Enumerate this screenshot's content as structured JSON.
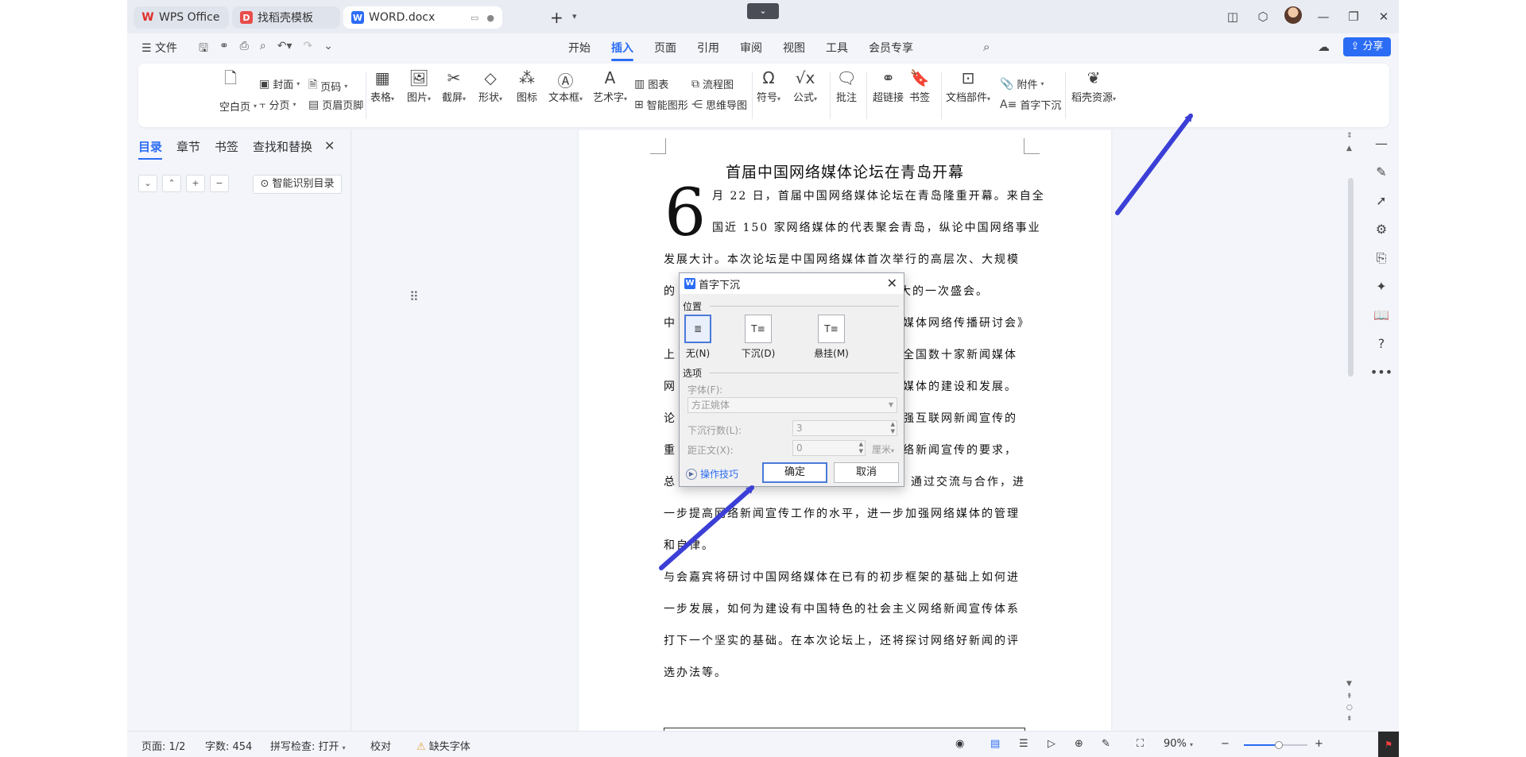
{
  "tabs": [
    {
      "label": "WPS Office",
      "logo": "W"
    },
    {
      "label": "找稻壳模板",
      "logo": "D"
    },
    {
      "label": "WORD.docx",
      "logo": "W"
    }
  ],
  "menu": {
    "file": "文件",
    "items": [
      "开始",
      "插入",
      "页面",
      "引用",
      "审阅",
      "视图",
      "工具",
      "会员专享"
    ],
    "share": "分享"
  },
  "ribbon": {
    "blank_page": "空白页",
    "cover": "封面",
    "page_break": "分页",
    "page_number": "页码",
    "header_footer": "页眉页脚",
    "table": "表格",
    "picture": "图片",
    "screenshot": "截屏",
    "shape": "形状",
    "icon": "图标",
    "textbox": "文本框",
    "wordart": "艺术字",
    "chart": "图表",
    "smart_shape": "智能图形",
    "flowchart": "流程图",
    "mindmap": "思维导图",
    "symbol": "符号",
    "formula": "公式",
    "comment": "批注",
    "hyperlink": "超链接",
    "bookmark": "书签",
    "doc_parts": "文档部件",
    "attachment": "附件",
    "drop_cap": "首字下沉",
    "docer": "稻壳资源"
  },
  "nav": {
    "tabs": [
      "目录",
      "章节",
      "书签",
      "查找和替换"
    ],
    "smart_toc": "智能识别目录"
  },
  "document": {
    "title": "首届中国网络媒体论坛在青岛开幕",
    "dropcap": "6",
    "lines": [
      "月 22 日，首届中国网络媒体论坛在青岛隆重开幕。来自全",
      "国近 150 家网络媒体的代表聚会青岛，纵论中国网络事业",
      "发展大计。本次论坛是中国网络媒体首次举行的高层次、大规模",
      "的",
      "大的一次盛会。",
      "中",
      "媒体网络传播研讨会》",
      "上",
      "全国数十家新闻媒体",
      "网",
      "媒体的建设和发展。",
      "论",
      "强互联网新闻宣传的",
      "重",
      "络新闻宣传的要求，",
      "总",
      "通过交流与合作，进",
      "一步提高网络新闻宣传工作的水平，进一步加强网络媒体的管理",
      "和自律。",
      "与会嘉宾将研讨中国网络媒体在已有的初步框架的基础上如何进",
      "一步发展，如何为建设有中国特色的社会主义网络新闻宣传体系",
      "打下一个坚实的基础。在本次论坛上，还将探讨网络好新闻的评",
      "选办法等。"
    ]
  },
  "dialog": {
    "title": "首字下沉",
    "position_label": "位置",
    "options": [
      "无(N)",
      "下沉(D)",
      "悬挂(M)"
    ],
    "options_group": "选项",
    "font_label": "字体(F):",
    "font_value": "方正姚体",
    "lines_label": "下沉行数(L):",
    "lines_value": "3",
    "distance_label": "距正文(X):",
    "distance_value": "0",
    "distance_unit": "厘米",
    "tips": "操作技巧",
    "ok": "确定",
    "cancel": "取消"
  },
  "status": {
    "page": "页面: 1/2",
    "words": "字数: 454",
    "spell": "拼写检查: 打开",
    "proof": "校对",
    "missing_font": "缺失字体",
    "zoom": "90%",
    "zoom_fraction": 0.55
  },
  "colors": {
    "accent": "#2b6cf5",
    "arrow": "#3b3fd6",
    "warning": "#e6a23c"
  }
}
